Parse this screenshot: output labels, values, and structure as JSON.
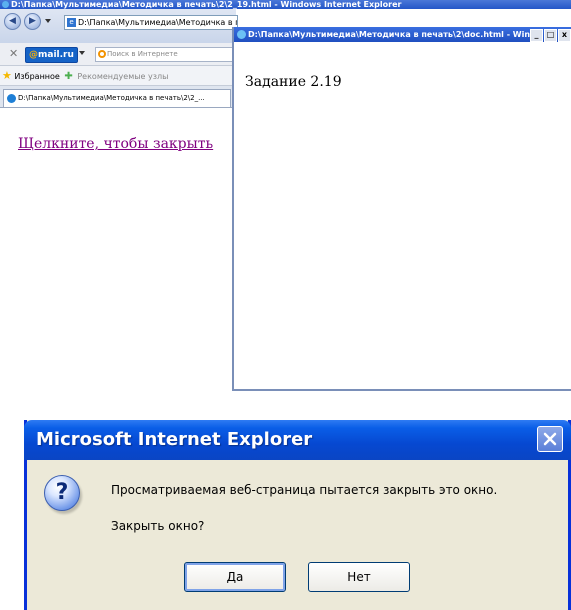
{
  "main_window": {
    "title": "D:\\Папка\\Мультимедиа\\Методичка в печать\\2\\2_19.html - Windows Internet Explorer",
    "address": "D:\\Папка\\Мультимедиа\\Методичка в г",
    "search_logo_prefix": "@",
    "search_logo": "mail.ru",
    "search_placeholder": "Поиск в Интернете",
    "favorites_label": "Избранное",
    "recommended_label": "Рекомендуемые узлы",
    "tab_title": "D:\\Папка\\Мультимедиа\\Методичка в печать\\2\\2_...",
    "close_link_text": "Щелкните, чтобы закрыть"
  },
  "popup_window": {
    "title": "D:\\Папка\\Мультимедиа\\Методичка в печать\\2\\doc.html - Win...",
    "content_text": "Задание 2.19"
  },
  "dialog": {
    "title": "Microsoft Internet Explorer",
    "message": "Просматриваемая веб-страница пытается закрыть это окно.",
    "question": "Закрыть окно?",
    "yes_label": "Да",
    "no_label": "Нет"
  },
  "icons": [
    "ie-icon",
    "back-icon",
    "forward-icon",
    "close-x-icon",
    "star-icon",
    "question-icon",
    "minimize-icon",
    "maximize-icon",
    "close-icon"
  ],
  "colors": {
    "titlebar_blue": "#0a5ee7",
    "dialog_bg": "#ece9d8",
    "link_visited": "#800080"
  }
}
